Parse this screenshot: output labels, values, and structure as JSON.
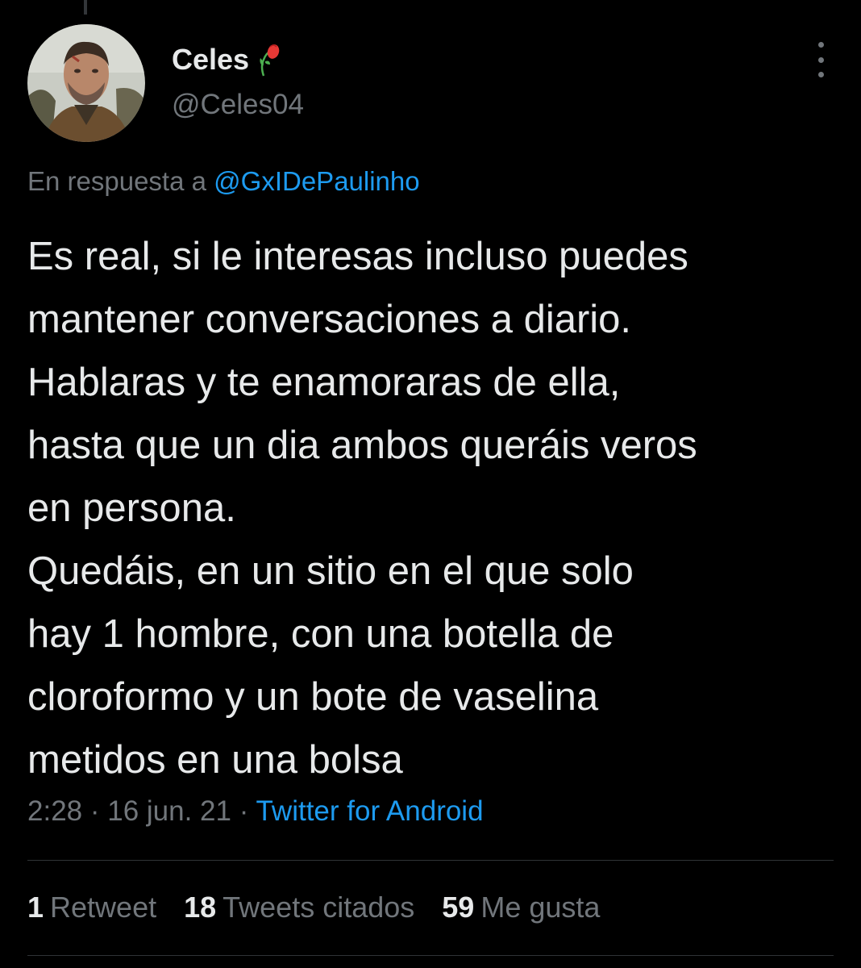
{
  "tweet": {
    "author": {
      "display_name": "Celes",
      "handle": "@Celes04",
      "name_emoji": "wilted-flower-icon"
    },
    "reply_prefix": "En respuesta a",
    "reply_to": "@GxIDePaulinho",
    "text_lines": [
      "Es real, si le interesas incluso puedes",
      "mantener conversaciones a diario.",
      "Hablaras y te enamoraras de ella,",
      "hasta que un dia ambos queráis veros",
      "en persona.",
      "Quedáis, en un sitio en el que solo",
      "hay 1 hombre, con una botella de",
      "cloroformo y un bote de vaselina",
      "metidos en una bolsa"
    ],
    "time": "2:28",
    "separator": "·",
    "date": "16 jun. 21",
    "source": "Twitter for Android",
    "stats": {
      "retweets_count": "1",
      "retweets_label": "Retweet",
      "quotes_count": "18",
      "quotes_label": "Tweets citados",
      "likes_count": "59",
      "likes_label": "Me gusta"
    }
  },
  "colors": {
    "background": "#000000",
    "primary_text": "#e7e9ea",
    "secondary_text": "#71767b",
    "link": "#1d9bf0",
    "divider": "#2f3336"
  }
}
